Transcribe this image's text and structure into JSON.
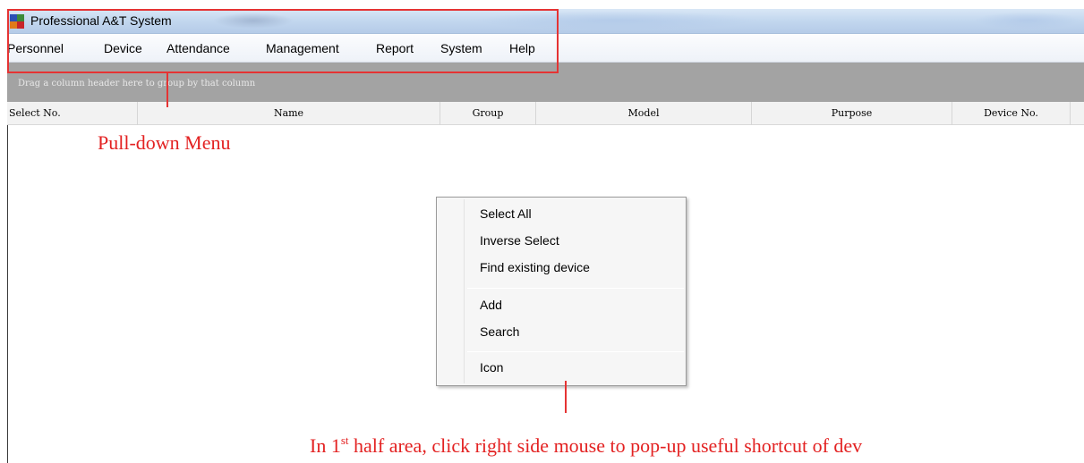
{
  "window": {
    "title": "Professional A&T System",
    "app_icon": "app-logo-icon"
  },
  "menubar": {
    "items": [
      "Personnel",
      "Device",
      "Attendance",
      "Management",
      "Report",
      "System",
      "Help"
    ]
  },
  "grid": {
    "group_hint": "Drag a column header here to group by that column",
    "columns": [
      "Select No.",
      "Name",
      "Group",
      "Model",
      "Purpose",
      "Device No."
    ]
  },
  "context_menu": {
    "groups": [
      [
        "Select All",
        "Inverse Select",
        "Find existing device"
      ],
      [
        "Add",
        "Search"
      ],
      [
        "Icon"
      ]
    ]
  },
  "annotations": {
    "pulldown_label": "Pull-down Menu",
    "shortcut_label_pre": "In 1",
    "shortcut_label_sup": "st",
    "shortcut_label_post": " half area, click right side mouse to pop-up useful shortcut of dev",
    "color": "#e53333"
  }
}
